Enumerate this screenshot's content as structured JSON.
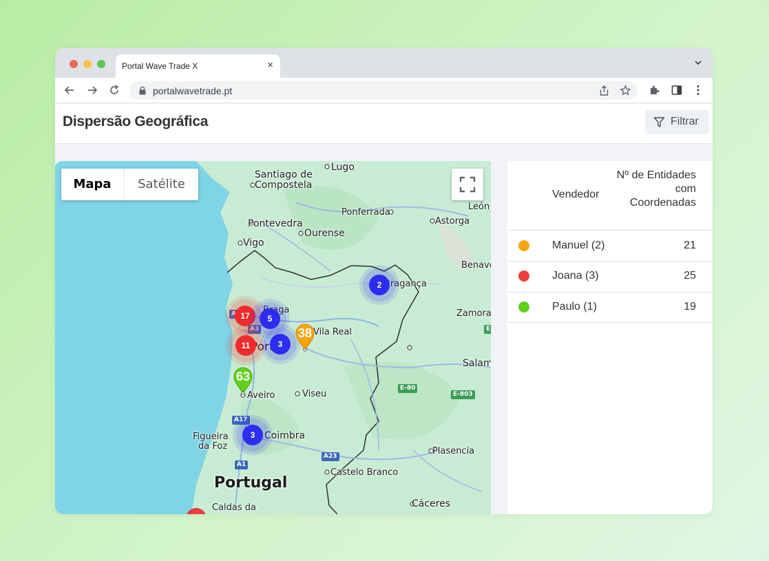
{
  "browser": {
    "tab_title": "Portal Wave Trade X",
    "tab_close": "×",
    "url": "portalwavetrade.pt"
  },
  "header": {
    "title": "Dispersão Geográfica",
    "filter_label": "Filtrar"
  },
  "map": {
    "type_options": [
      "Mapa",
      "Satélite"
    ],
    "selected_type": "Mapa",
    "country_label": "Portugal",
    "places": [
      "Lugo",
      "Santiago de",
      "Compostela",
      "Ponferrada",
      "León",
      "Astorga",
      "Pontevedra",
      "Ourense",
      "Vigo",
      "Benave",
      "Bragança",
      "Braga",
      "Vila Real",
      "Zamora",
      "Porto",
      "Salam",
      "Aveiro",
      "Viseu",
      "Coimbra",
      "Figueira",
      "da Foz",
      "Plasencia",
      "Castelo Branco",
      "Cáceres",
      "Caldas da"
    ],
    "road_labels": [
      "A3",
      "A28",
      "E-80",
      "E-803",
      "A17",
      "A23",
      "A1",
      "E"
    ],
    "clusters": [
      "17",
      "5",
      "11",
      "3",
      "2",
      "3"
    ],
    "markers": [
      "38",
      "63"
    ]
  },
  "panel": {
    "col_vendor": "Vendedor",
    "col_count": "Nº de Entidades com Coordenadas",
    "rows": [
      {
        "name": "Manuel (2)",
        "value": "21",
        "color": "#f7a40d"
      },
      {
        "name": "Joana (3)",
        "value": "25",
        "color": "#f03c3c"
      },
      {
        "name": "Paulo (1)",
        "value": "19",
        "color": "#5fd11c"
      }
    ]
  },
  "colors": {
    "cluster_red": "#ef2b2b",
    "cluster_blue": "#2d2df0",
    "marker_orange": "#f7a40d",
    "marker_green": "#5fd11c",
    "sea": "#7fd4e6",
    "land": "#c8ecd3"
  }
}
